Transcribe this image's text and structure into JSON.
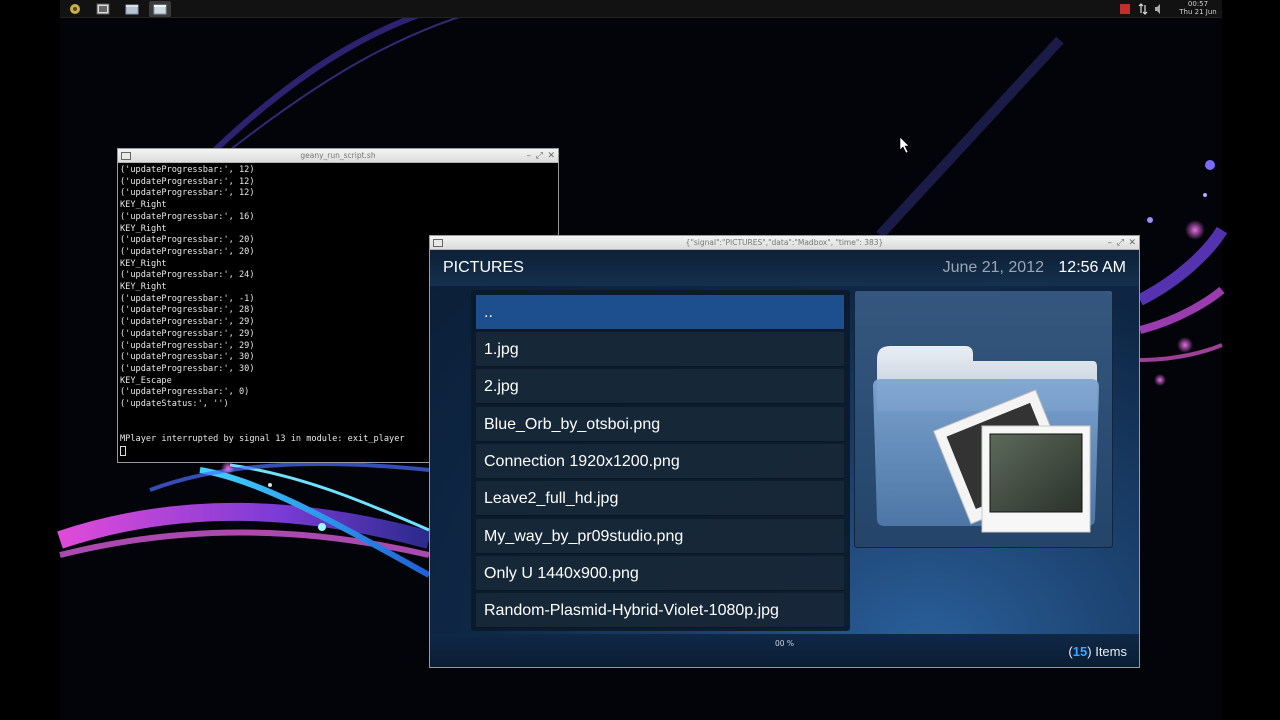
{
  "colors": {
    "accent": "#3aa7ff",
    "selection": "#1d4f8f",
    "tray_red": "#c0302a"
  },
  "taskbar": {
    "buttons": [
      {
        "icon": "app-menu-icon"
      },
      {
        "icon": "image-viewer-icon"
      },
      {
        "icon": "window-icon"
      },
      {
        "icon": "window-icon"
      }
    ],
    "tray": {
      "icons": [
        "record-icon",
        "network-icon",
        "volume-icon"
      ],
      "clock_time": "00:57",
      "clock_date": "Thu 21 Jun"
    }
  },
  "terminal": {
    "title": "geany_run_script.sh",
    "lines": [
      "('updateProgressbar:', 12)",
      "('updateProgressbar:', 12)",
      "('updateProgressbar:', 12)",
      "KEY_Right",
      "('updateProgressbar:', 16)",
      "KEY_Right",
      "('updateProgressbar:', 20)",
      "('updateProgressbar:', 20)",
      "KEY_Right",
      "('updateProgressbar:', 24)",
      "KEY_Right",
      "('updateProgressbar:', -1)",
      "('updateProgressbar:', 28)",
      "('updateProgressbar:', 29)",
      "('updateProgressbar:', 29)",
      "('updateProgressbar:', 29)",
      "('updateProgressbar:', 30)",
      "('updateProgressbar:', 30)",
      "KEY_Escape",
      "('updateProgressbar:', 0)",
      "('updateStatus:', '')",
      "",
      "",
      "MPlayer interrupted by signal 13 in module: exit_player"
    ]
  },
  "media": {
    "window_title": "{\"signal\":\"PICTURES\",\"data\":\"Madbox\", \"time\": 383}",
    "section_title": "PICTURES",
    "date": "June 21, 2012",
    "time": "12:56 AM",
    "items": [
      "..",
      "1.jpg",
      "2.jpg",
      "Blue_Orb_by_otsboi.png",
      "Connection 1920x1200.png",
      "Leave2_full_hd.jpg",
      "My_way_by_pr09studio.png",
      "Only U 1440x900.png",
      "Random-Plasmid-Hybrid-Violet-1080p.jpg"
    ],
    "selected_index": 0,
    "thumbnail_icon": "picture-folder-icon",
    "progress_text": "00 %",
    "item_count": "15",
    "item_count_open": "(",
    "item_count_close": ")",
    "items_label": "Items"
  }
}
